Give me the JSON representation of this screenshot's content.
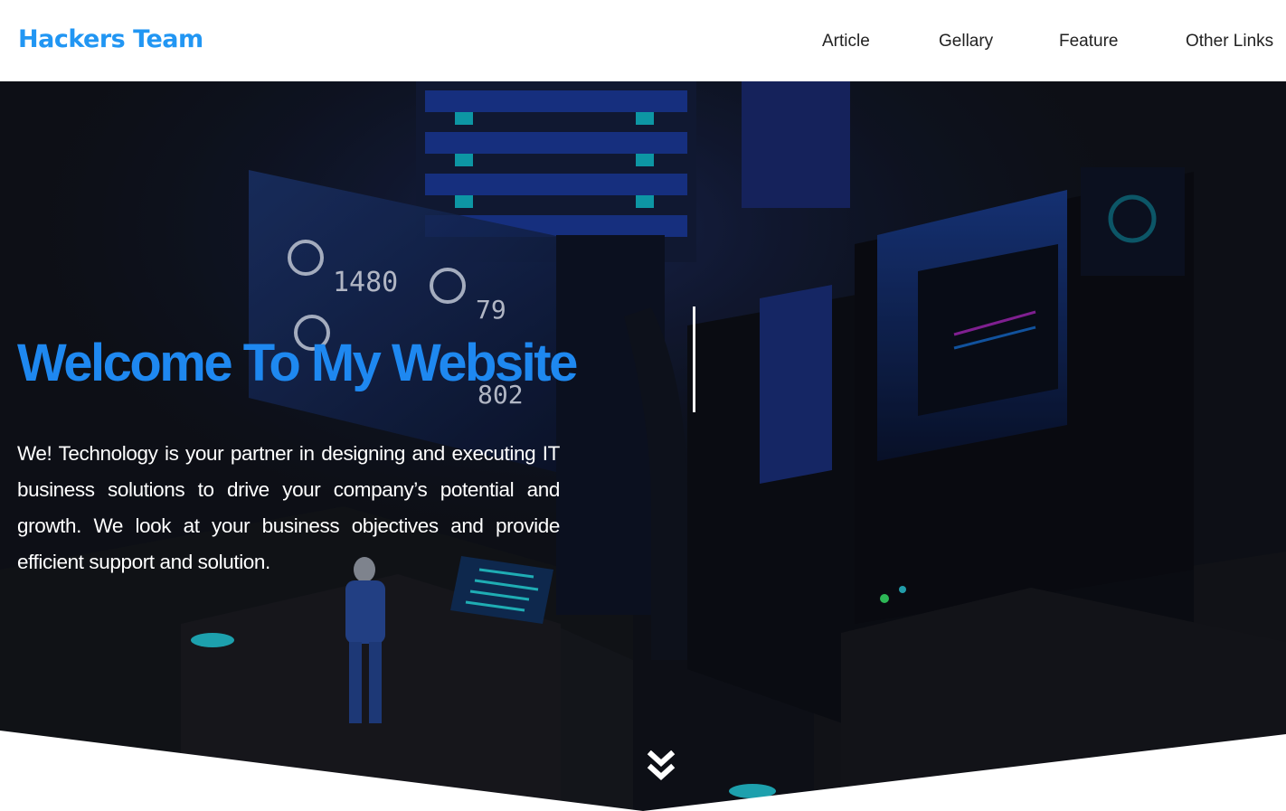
{
  "header": {
    "logo": "Hackers Team",
    "nav": [
      {
        "label": "Article"
      },
      {
        "label": "Gellary"
      },
      {
        "label": "Feature"
      },
      {
        "label": "Other Links"
      }
    ]
  },
  "hero": {
    "title": "Welcome To My Website",
    "description": "We! Technology is your partner in designing and executing IT business solutions to drive your company’s potential and growth. We look at your business objectives and provide efficient support and solution.",
    "dashboard_values": [
      "1480",
      "79",
      "802"
    ],
    "scroll_icon": "double-chevron-down-icon"
  },
  "colors": {
    "accent": "#2196f3",
    "title": "#1e88f0",
    "background": "#0d1017"
  }
}
